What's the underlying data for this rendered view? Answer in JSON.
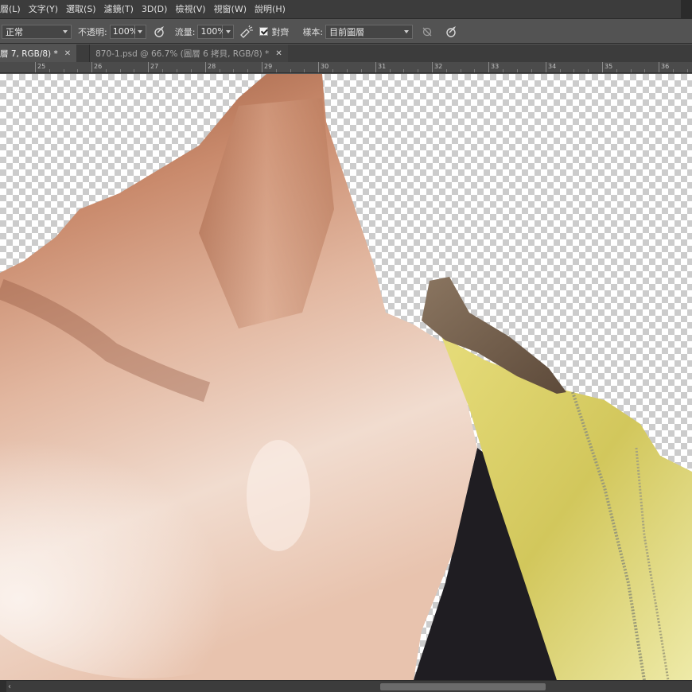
{
  "menu": {
    "items": [
      "層(L)",
      "文字(Y)",
      "選取(S)",
      "濾鏡(T)",
      "3D(D)",
      "檢視(V)",
      "視窗(W)",
      "說明(H)"
    ]
  },
  "options": {
    "mode_value": "正常",
    "opacity_label": "不透明:",
    "opacity_value": "100%",
    "flow_label": "流量:",
    "flow_value": "100%",
    "aligned_label": "對齊",
    "aligned_checked": true,
    "sample_label": "樣本:",
    "sample_value": "目前圖層"
  },
  "tabs": [
    {
      "label": "層 7, RGB/8) *",
      "active": true
    },
    {
      "label": "870-1.psd @ 66.7% (圖層 6 拷貝, RGB/8) *",
      "active": false
    }
  ],
  "ruler": {
    "labels": [
      "25",
      "26",
      "27",
      "28",
      "29",
      "30",
      "31",
      "32",
      "33",
      "34",
      "35",
      "36"
    ]
  },
  "colors": {
    "skin_light": "#f1dccf",
    "skin_mid": "#d9a58a",
    "skin_shadow": "#9a5a3e",
    "garment_yellow": "#d8cf6a",
    "top_black": "#1f1d22",
    "ui_dark": "#3c3c3c",
    "ui_mid": "#535353"
  },
  "icons": {
    "pressure_opacity": "pen-pressure-icon",
    "airbrush": "airbrush-icon",
    "ignore_adjustment": "ignore-adjustment-layers-icon",
    "pressure_size": "pen-pressure-size-icon",
    "close": "close-icon",
    "scroll_left": "scroll-left-arrow-icon"
  }
}
